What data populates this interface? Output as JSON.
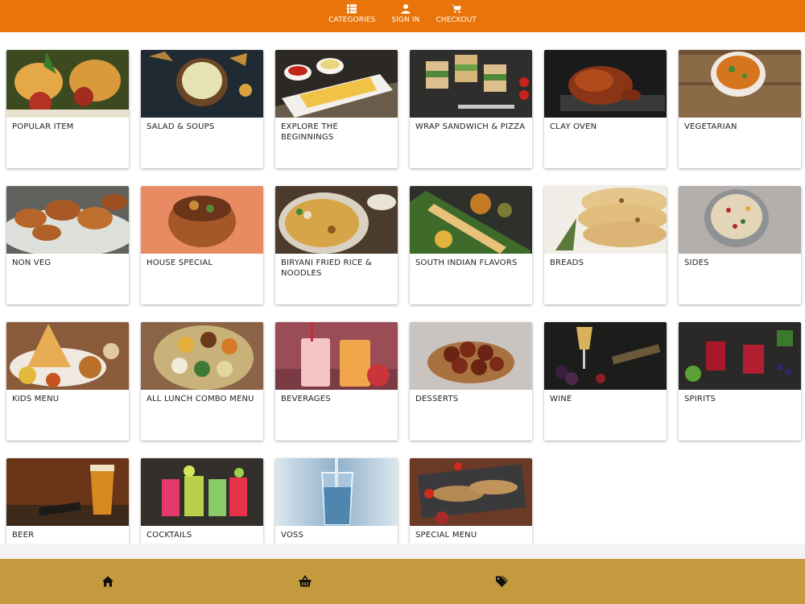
{
  "nav": {
    "categories_label": "CATEGORIES",
    "signin_label": "SIGN IN",
    "checkout_label": "CHECKOUT"
  },
  "colors": {
    "header": "#e8740a",
    "footer": "#c39a3e"
  },
  "categories": [
    {
      "label": "POPULAR ITEM",
      "icon": "fried-snacks-photo"
    },
    {
      "label": "SALAD & SOUPS",
      "icon": "soup-bowl-photo"
    },
    {
      "label": "EXPLORE THE BEGINNINGS",
      "icon": "french-fries-photo"
    },
    {
      "label": "WRAP SANDWICH & PIZZA",
      "icon": "sandwich-photo"
    },
    {
      "label": "CLAY OVEN",
      "icon": "tandoori-chicken-photo"
    },
    {
      "label": "VEGETARIAN",
      "icon": "curry-bowl-photo"
    },
    {
      "label": "NON VEG",
      "icon": "chicken-pieces-photo"
    },
    {
      "label": "HOUSE SPECIAL",
      "icon": "special-bowl-photo"
    },
    {
      "label": "BIRYANI FRIED RICE & NOODLES",
      "icon": "biryani-photo"
    },
    {
      "label": "SOUTH INDIAN FLAVORS",
      "icon": "dosa-photo"
    },
    {
      "label": "BREADS",
      "icon": "naan-photo"
    },
    {
      "label": "SIDES",
      "icon": "rice-bowl-photo"
    },
    {
      "label": "KIDS MENU",
      "icon": "kids-dosa-photo"
    },
    {
      "label": "ALL LUNCH COMBO MENU",
      "icon": "thali-photo"
    },
    {
      "label": "BEVERAGES",
      "icon": "lassi-photo"
    },
    {
      "label": "DESSERTS",
      "icon": "gulab-jamun-photo"
    },
    {
      "label": "WINE",
      "icon": "wine-photo"
    },
    {
      "label": "SPIRITS",
      "icon": "spirits-photo"
    },
    {
      "label": "BEER",
      "icon": "beer-photo"
    },
    {
      "label": "COCKTAILS",
      "icon": "cocktails-photo"
    },
    {
      "label": "VOSS",
      "icon": "water-glass-photo"
    },
    {
      "label": "SPECIAL MENU",
      "icon": "fish-platter-photo"
    }
  ],
  "footer": {
    "home_icon": "home-icon",
    "basket_icon": "basket-icon",
    "tag_icon": "tags-icon"
  }
}
